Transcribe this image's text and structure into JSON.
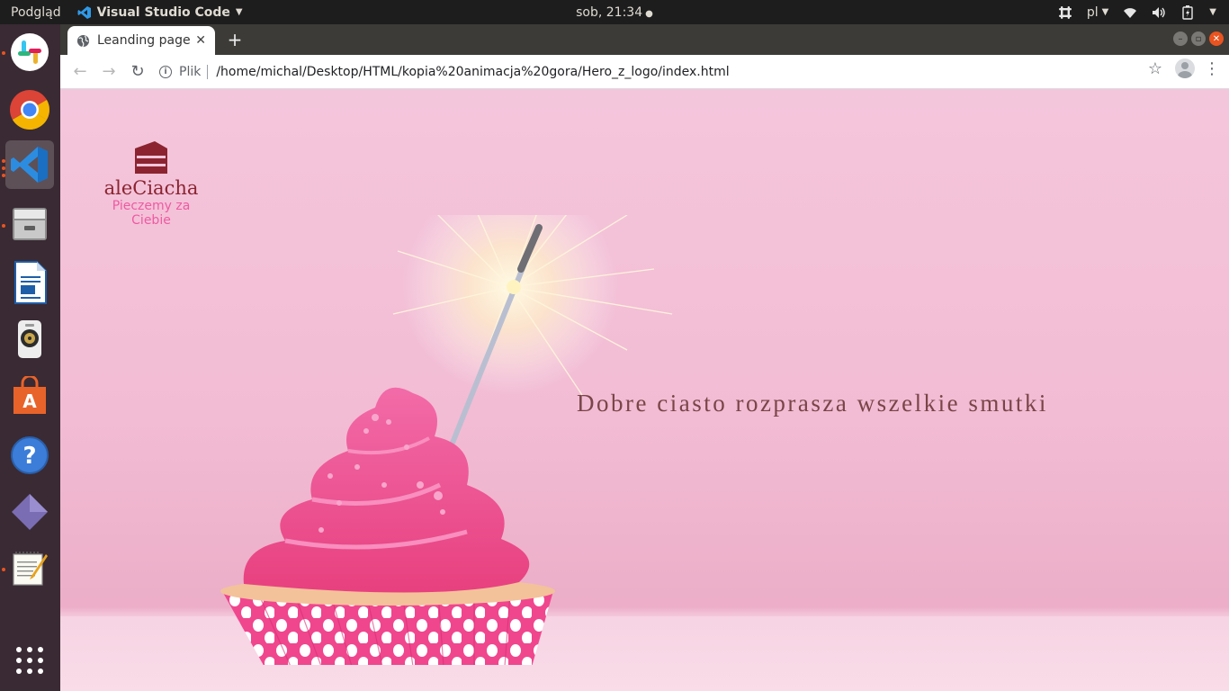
{
  "top_panel": {
    "activities": "Podgląd",
    "app_name": "Visual Studio Code",
    "clock": "sob, 21:34",
    "keyboard_layout": "pl",
    "tray_icons": [
      "slack-tray-icon",
      "wifi-icon",
      "volume-icon",
      "battery-icon",
      "system-menu-icon"
    ]
  },
  "dock": {
    "items": [
      {
        "name": "slack",
        "icon": "slack-icon",
        "running": true,
        "active": false
      },
      {
        "name": "chrome",
        "icon": "chrome-icon",
        "running": false,
        "active": false
      },
      {
        "name": "vscode",
        "icon": "vscode-icon",
        "running": true,
        "active": true
      },
      {
        "name": "files",
        "icon": "files-icon",
        "running": true,
        "active": false
      },
      {
        "name": "writer",
        "icon": "libreoffice-writer-icon",
        "running": false,
        "active": false
      },
      {
        "name": "rhythmbox",
        "icon": "speaker-icon",
        "running": false,
        "active": false
      },
      {
        "name": "software",
        "icon": "software-center-icon",
        "running": false,
        "active": false
      },
      {
        "name": "help",
        "icon": "help-icon",
        "running": false,
        "active": false
      },
      {
        "name": "other",
        "icon": "diamond-app-icon",
        "running": false,
        "active": false
      },
      {
        "name": "text-editor",
        "icon": "text-editor-icon",
        "running": true,
        "active": false
      }
    ],
    "show_apps": "app-grid-icon"
  },
  "browser": {
    "tab_title": "Leanding page",
    "address_scheme": "Plik",
    "address_url": "/home/michal/Desktop/HTML/kopia%20animacja%20gora/Hero_z_logo/index.html"
  },
  "page": {
    "logo_name": "aleCiacha",
    "logo_tagline": "Pieczemy za Ciebie",
    "tagline": "Dobre ciasto rozprasza wszelkie smutki"
  },
  "colors": {
    "accent": "#e95420",
    "page_bg": "#f4c6dc",
    "logo_brown": "#8b2430",
    "logo_pink": "#ee5aa0",
    "tagline": "#7a4547",
    "cupcake_pink": "#f0468e"
  }
}
